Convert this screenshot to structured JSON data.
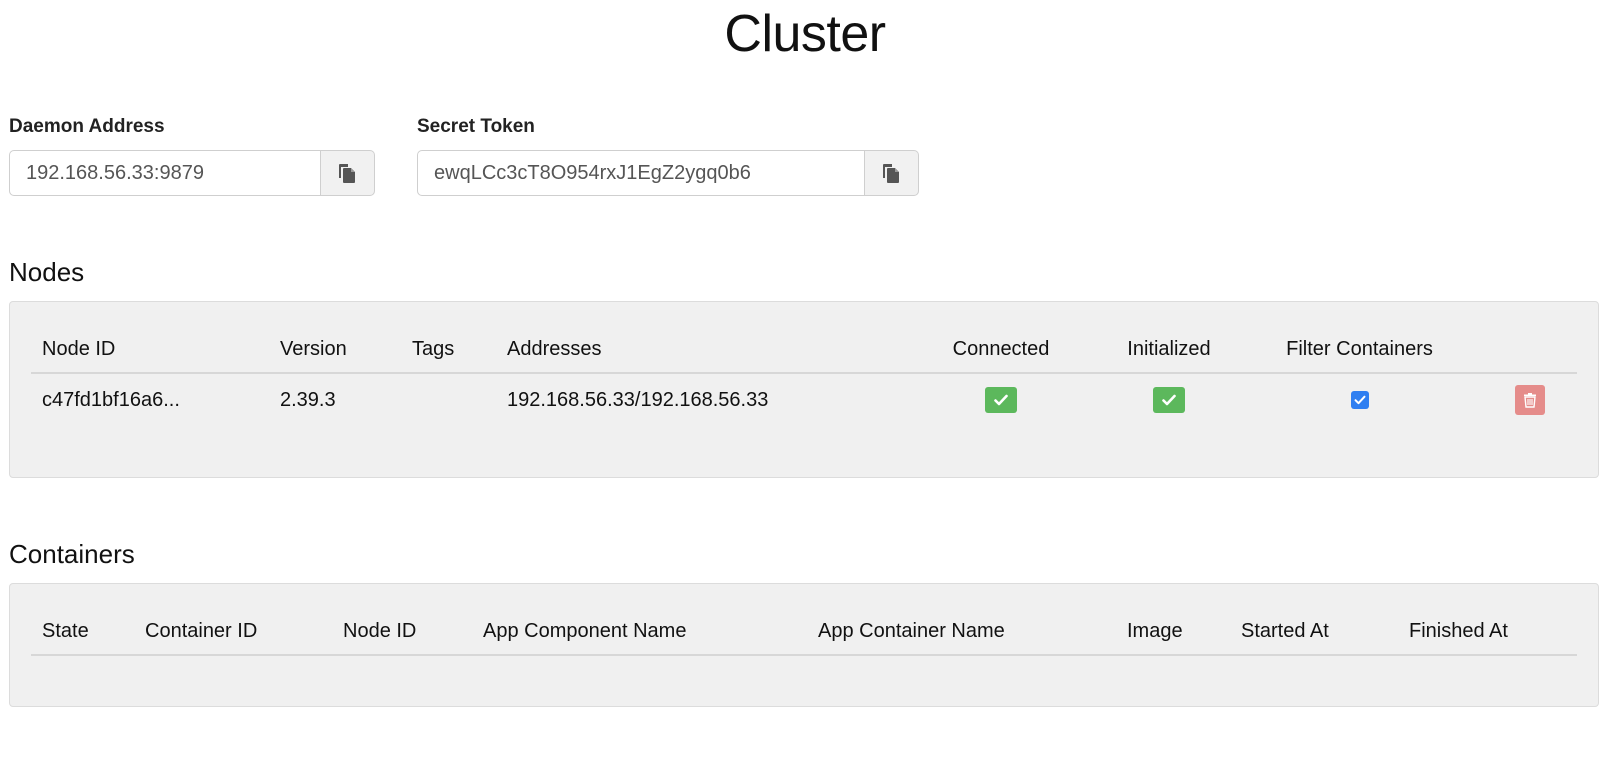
{
  "page": {
    "title": "Cluster"
  },
  "daemon": {
    "label": "Daemon Address",
    "value": "192.168.56.33:9879",
    "copy_icon": "clipboard-icon"
  },
  "token": {
    "label": "Secret Token",
    "value": "ewqLCc3cT8O954rxJ1EgZ2ygq0b6",
    "copy_icon": "clipboard-icon"
  },
  "nodes": {
    "title": "Nodes",
    "columns": [
      "Node ID",
      "Version",
      "Tags",
      "Addresses",
      "Connected",
      "Initialized",
      "Filter Containers",
      ""
    ],
    "rows": [
      {
        "node_id": "c47fd1bf16a6...",
        "version": "2.39.3",
        "tags": "",
        "addresses": "192.168.56.33/192.168.56.33",
        "connected": true,
        "initialized": true,
        "filter_containers": true,
        "delete_icon": "trash-icon"
      }
    ]
  },
  "containers": {
    "title": "Containers",
    "columns": [
      "State",
      "Container ID",
      "Node ID",
      "App Component Name",
      "App Container Name",
      "Image",
      "Started At",
      "Finished At"
    ],
    "rows": []
  },
  "colors": {
    "ok_badge": "#5cb85c",
    "checkbox": "#2f7ff1",
    "delete": "#e58c8a",
    "panel_bg": "#f0f0f0"
  }
}
